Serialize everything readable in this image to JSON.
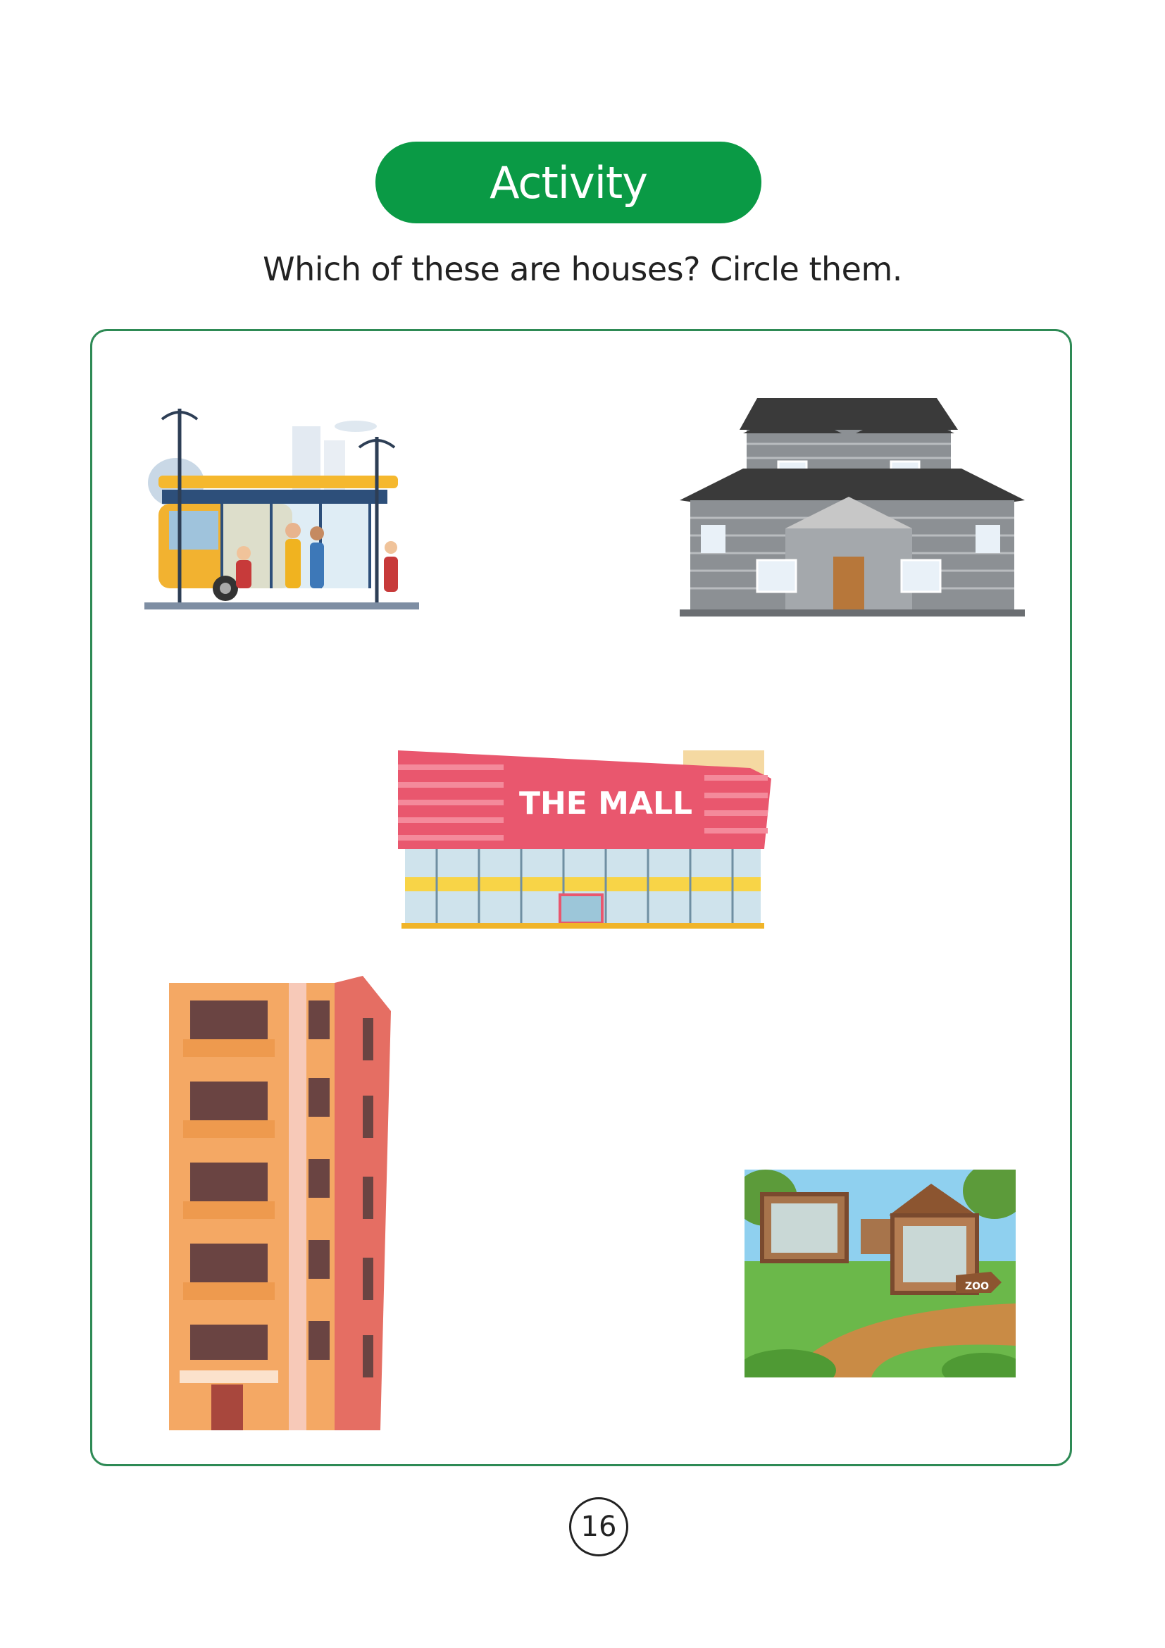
{
  "header": {
    "title": "Activity",
    "instruction": "Which of these are houses? Circle them."
  },
  "colors": {
    "accent": "#0a9a45",
    "frame_border": "#2e8a55"
  },
  "pictures": [
    {
      "name": "bus-stop",
      "icon": "bus-stop-illustration"
    },
    {
      "name": "house",
      "icon": "house-illustration"
    },
    {
      "name": "mall",
      "icon": "mall-illustration",
      "sign_text": "THE MALL"
    },
    {
      "name": "apartment-building",
      "icon": "apartment-building-illustration"
    },
    {
      "name": "zoo",
      "icon": "zoo-illustration",
      "sign_text": "ZOO"
    }
  ],
  "footer": {
    "page_number": "16"
  }
}
